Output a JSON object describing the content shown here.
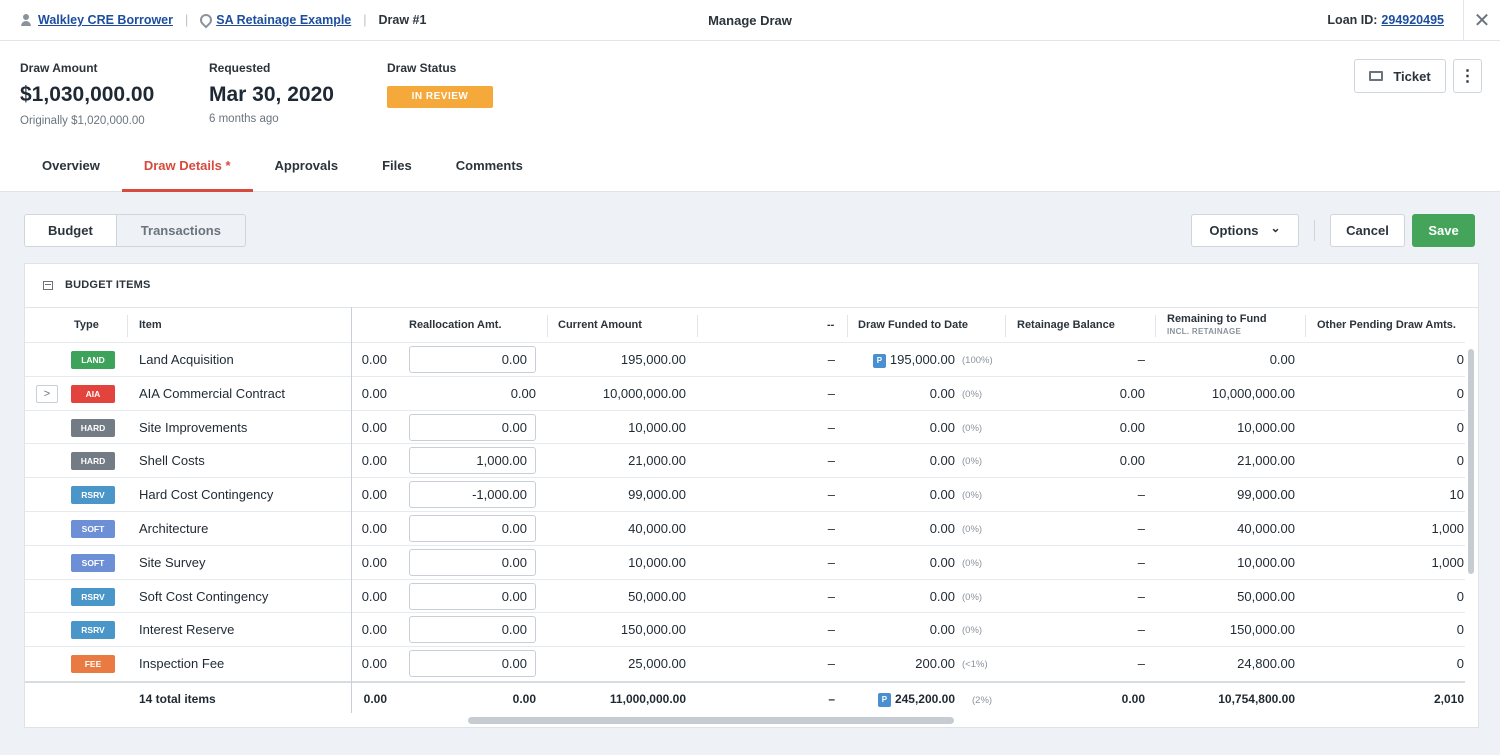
{
  "topbar": {
    "borrower": "Walkley CRE Borrower",
    "project": "SA Retainage Example",
    "draw": "Draw #1",
    "title": "Manage Draw",
    "loan_label": "Loan ID:",
    "loan_id": "294920495",
    "close_glyph": "✕"
  },
  "header": {
    "draw_amount_label": "Draw Amount",
    "draw_amount": "$1,030,000.00",
    "originally": "Originally $1,020,000.00",
    "requested_label": "Requested",
    "requested_date": "Mar 30, 2020",
    "requested_ago": "6 months ago",
    "status_label": "Draw Status",
    "status": "IN REVIEW",
    "status_color": "#f5a93b",
    "ticket_label": "Ticket",
    "more_glyph": "⋮"
  },
  "tabs": [
    "Overview",
    "Draw Details *",
    "Approvals",
    "Files",
    "Comments"
  ],
  "toolbar": {
    "segments": [
      "Budget",
      "Transactions"
    ],
    "options_label": "Options",
    "options_glyph": "⌄",
    "cancel_label": "Cancel",
    "save_label": "Save"
  },
  "budget": {
    "title": "BUDGET ITEMS",
    "headers": {
      "type": "Type",
      "item": "Item",
      "reallocation": "Reallocation Amt.",
      "current": "Current Amount",
      "dash": "--",
      "funded": "Draw Funded to Date",
      "retainage": "Retainage Balance",
      "remaining": "Remaining to Fund",
      "remaining_sub": "INCL. RETAINAGE",
      "pending": "Other Pending Draw Amts."
    },
    "rows": [
      {
        "type": "LAND",
        "color": "#3ea35a",
        "item": "Land Acquisition",
        "first": "0.00",
        "realloc": "0.00",
        "input": true,
        "current": "195,000.00",
        "dash": "–",
        "funded": "195,000.00",
        "pct": "(100%)",
        "pbadge": "P",
        "retain": "–",
        "remaining": "0.00",
        "pending": "0",
        "expand": false
      },
      {
        "type": "AIA",
        "color": "#e2433c",
        "item": "AIA Commercial Contract",
        "first": "0.00",
        "realloc": "0.00",
        "input": false,
        "current": "10,000,000.00",
        "dash": "–",
        "funded": "0.00",
        "pct": "(0%)",
        "pbadge": "",
        "retain": "0.00",
        "remaining": "10,000,000.00",
        "pending": "0",
        "expand": true
      },
      {
        "type": "HARD",
        "color": "#737b84",
        "item": "Site Improvements",
        "first": "0.00",
        "realloc": "0.00",
        "input": true,
        "current": "10,000.00",
        "dash": "–",
        "funded": "0.00",
        "pct": "(0%)",
        "pbadge": "",
        "retain": "0.00",
        "remaining": "10,000.00",
        "pending": "0",
        "expand": false
      },
      {
        "type": "HARD",
        "color": "#737b84",
        "item": "Shell Costs",
        "first": "0.00",
        "realloc": "1,000.00",
        "input": true,
        "current": "21,000.00",
        "dash": "–",
        "funded": "0.00",
        "pct": "(0%)",
        "pbadge": "",
        "retain": "0.00",
        "remaining": "21,000.00",
        "pending": "0",
        "expand": false
      },
      {
        "type": "RSRV",
        "color": "#4a96c8",
        "item": "Hard Cost Contingency",
        "first": "0.00",
        "realloc": "-1,000.00",
        "input": true,
        "current": "99,000.00",
        "dash": "–",
        "funded": "0.00",
        "pct": "(0%)",
        "pbadge": "",
        "retain": "–",
        "remaining": "99,000.00",
        "pending": "10",
        "expand": false
      },
      {
        "type": "SOFT",
        "color": "#6d8fd6",
        "item": "Architecture",
        "first": "0.00",
        "realloc": "0.00",
        "input": true,
        "current": "40,000.00",
        "dash": "–",
        "funded": "0.00",
        "pct": "(0%)",
        "pbadge": "",
        "retain": "–",
        "remaining": "40,000.00",
        "pending": "1,000",
        "expand": false
      },
      {
        "type": "SOFT",
        "color": "#6d8fd6",
        "item": "Site Survey",
        "first": "0.00",
        "realloc": "0.00",
        "input": true,
        "current": "10,000.00",
        "dash": "–",
        "funded": "0.00",
        "pct": "(0%)",
        "pbadge": "",
        "retain": "–",
        "remaining": "10,000.00",
        "pending": "1,000",
        "expand": false
      },
      {
        "type": "RSRV",
        "color": "#4a96c8",
        "item": "Soft Cost Contingency",
        "first": "0.00",
        "realloc": "0.00",
        "input": true,
        "current": "50,000.00",
        "dash": "–",
        "funded": "0.00",
        "pct": "(0%)",
        "pbadge": "",
        "retain": "–",
        "remaining": "50,000.00",
        "pending": "0",
        "expand": false
      },
      {
        "type": "RSRV",
        "color": "#4a96c8",
        "item": "Interest Reserve",
        "first": "0.00",
        "realloc": "0.00",
        "input": true,
        "current": "150,000.00",
        "dash": "–",
        "funded": "0.00",
        "pct": "(0%)",
        "pbadge": "",
        "retain": "–",
        "remaining": "150,000.00",
        "pending": "0",
        "expand": false
      },
      {
        "type": "FEE",
        "color": "#e87a42",
        "item": "Inspection Fee",
        "first": "0.00",
        "realloc": "0.00",
        "input": true,
        "current": "25,000.00",
        "dash": "–",
        "funded": "200.00",
        "pct": "(<1%)",
        "pbadge": "",
        "retain": "–",
        "remaining": "24,800.00",
        "pending": "0",
        "expand": false
      }
    ],
    "totals": {
      "label": "14 total items",
      "first": "0.00",
      "realloc": "0.00",
      "current": "11,000,000.00",
      "dash": "–",
      "pbadge": "P",
      "funded": "245,200.00",
      "pct": "(2%)",
      "retain": "0.00",
      "remaining": "10,754,800.00",
      "pending": "2,010"
    }
  }
}
